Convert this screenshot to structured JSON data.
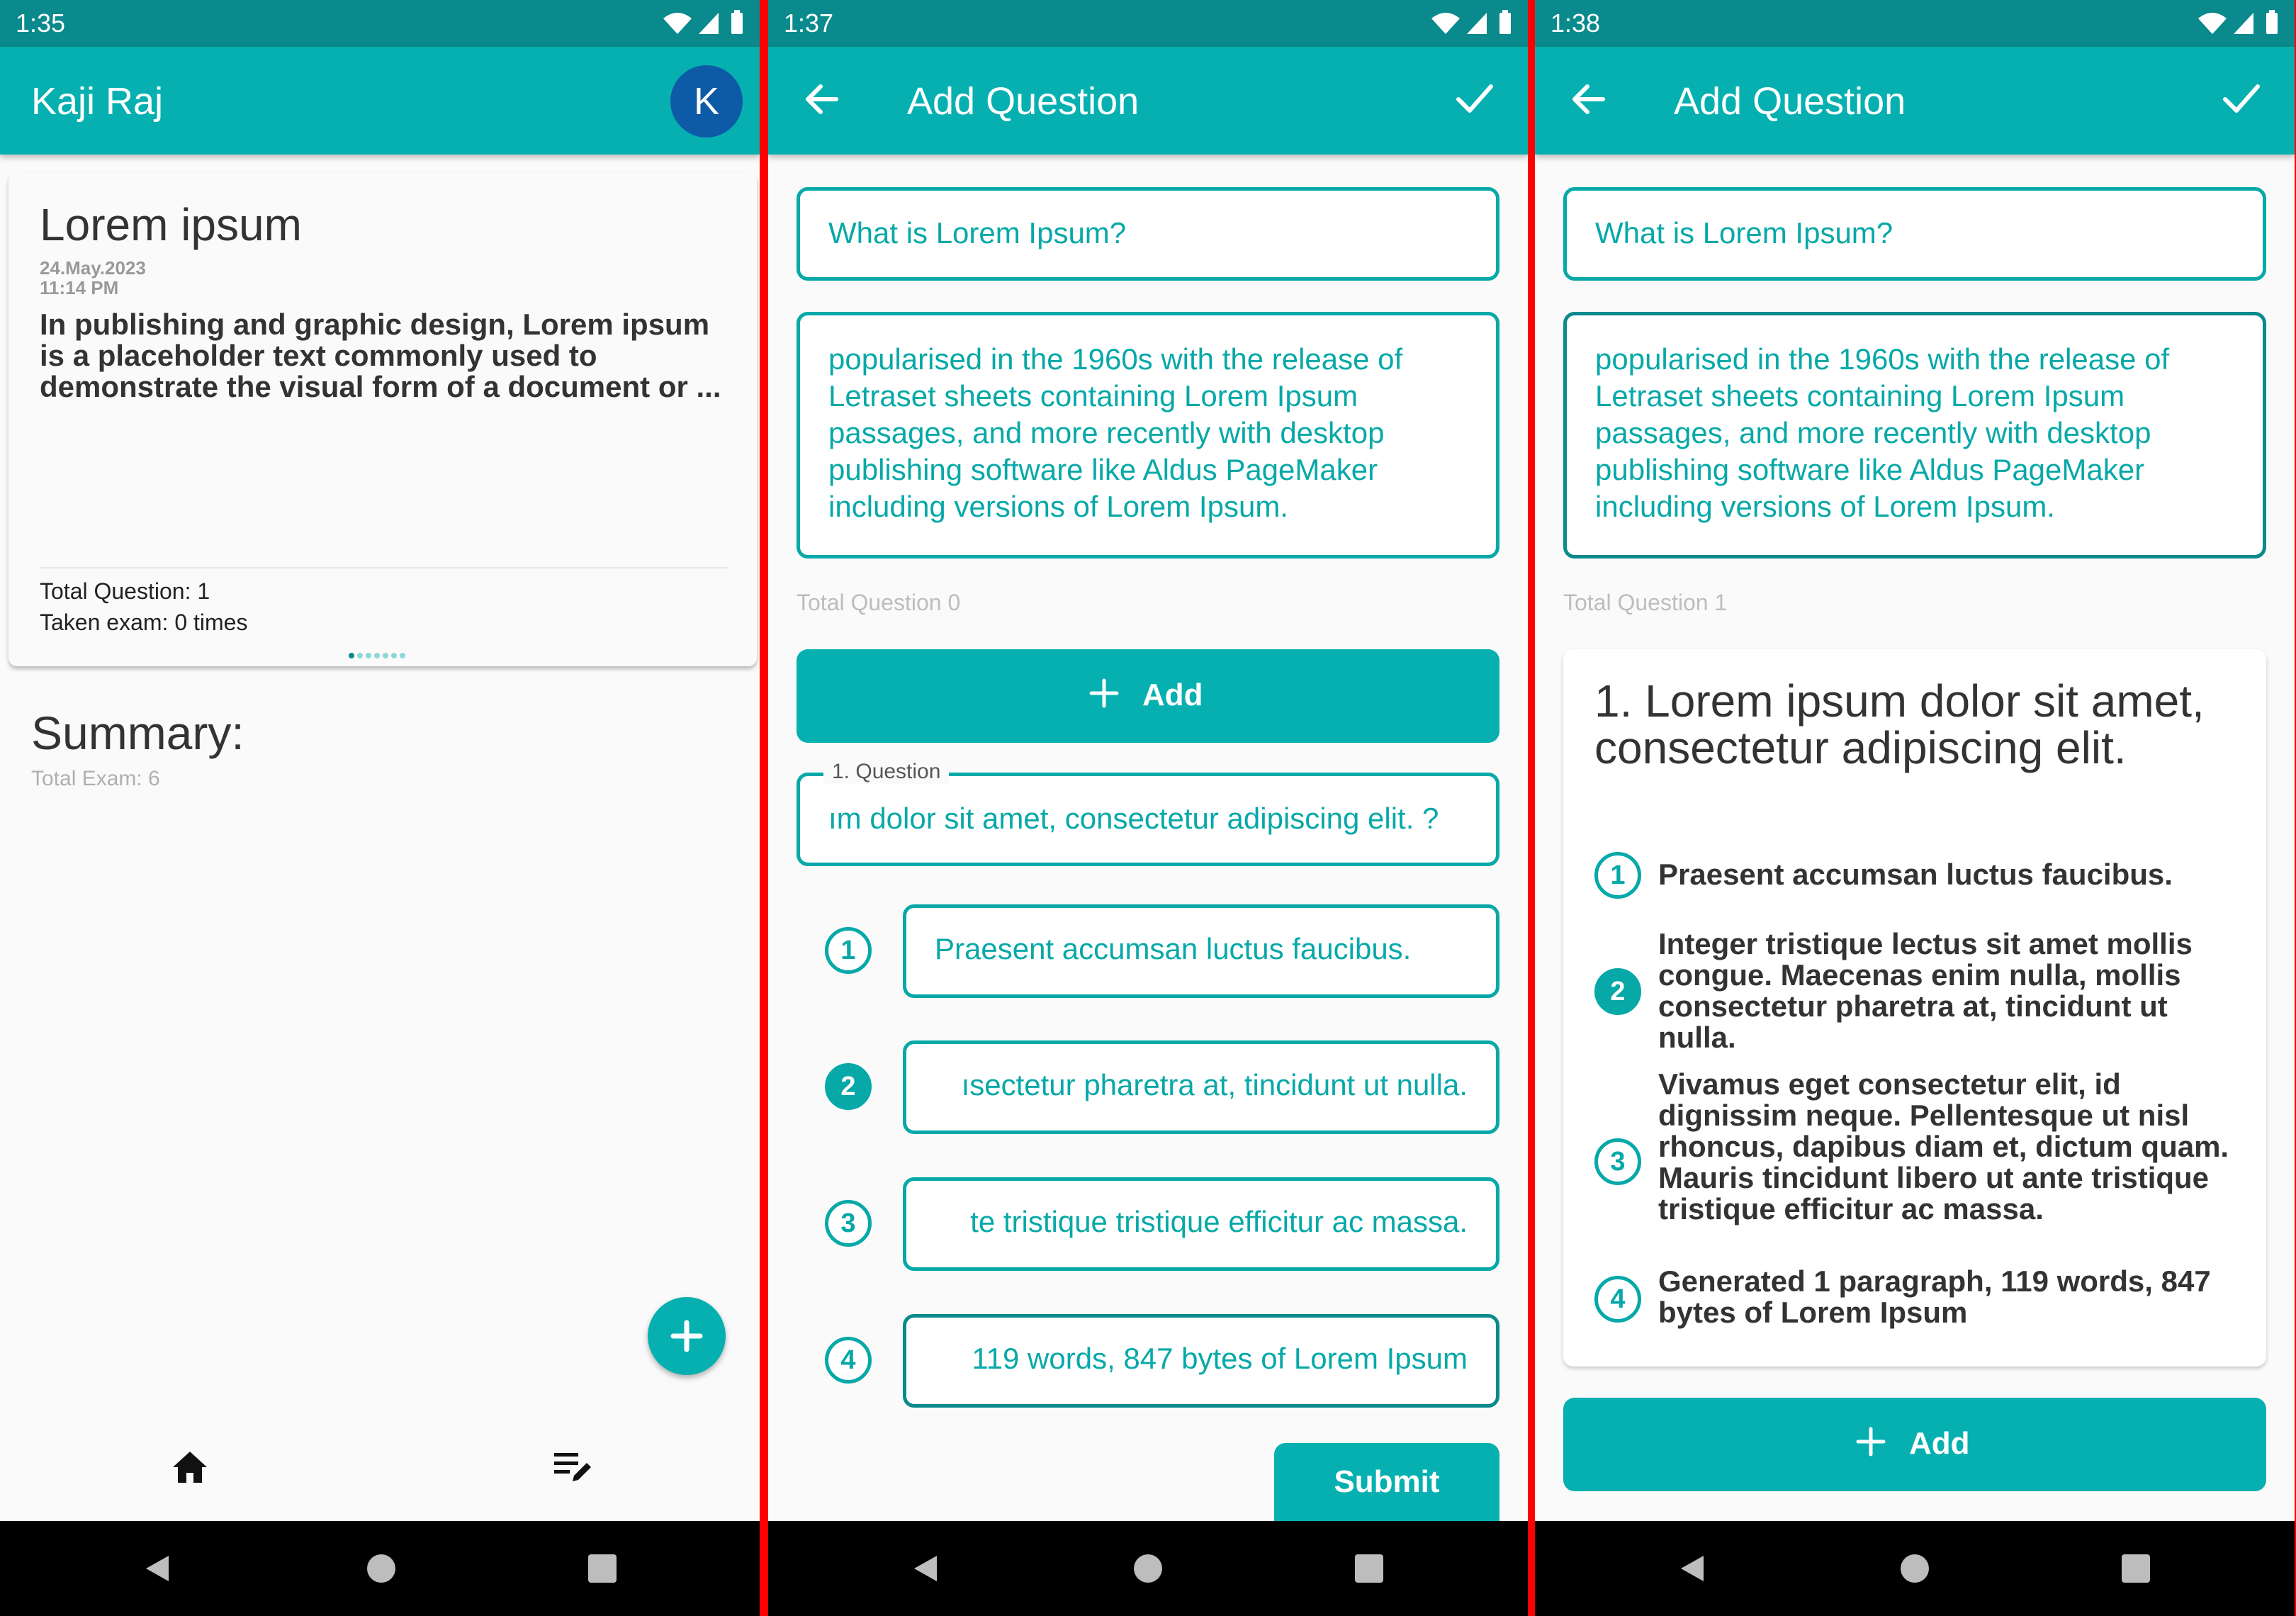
{
  "colors": {
    "teal": "#07b0b0",
    "dark_teal": "#0a8a8c",
    "divider": "#ff0000",
    "avatar": "#0d5aa6"
  },
  "screens": [
    {
      "time": "1:35",
      "app_title": "Kaji Raj",
      "avatar_letter": "K",
      "card": {
        "title": "Lorem ipsum",
        "date": "24.May.2023",
        "time": "11:14 PM",
        "body": "In publishing and graphic design, Lorem ipsum is a placeholder text commonly used to demonstrate the visual form of a document or ...",
        "total_question": "Total Question: 1",
        "taken_exam": "Taken exam: 0 times"
      },
      "summary_title": "Summary:",
      "summary_total": "Total Exam: 6",
      "fab_icon": "plus-icon",
      "nav_items": [
        "home-icon",
        "edit-note-icon"
      ]
    },
    {
      "time": "1:37",
      "app_title": "Add Question",
      "exam_title": "What is Lorem Ipsum?",
      "exam_description": "popularised in the 1960s with the release of Letraset sheets containing Lorem Ipsum passages, and more recently with desktop publishing software like Aldus PageMaker including versions of Lorem Ipsum.",
      "total_question": "Total Question 0",
      "add_label": "Add",
      "question_legend": "1. Question",
      "question_value": "ım dolor sit amet, consectetur adipiscing elit. ?",
      "options": [
        "1",
        "2",
        "3",
        "4"
      ],
      "option_values": [
        "Praesent accumsan luctus faucibus.",
        "ısectetur pharetra at, tincidunt ut nulla.",
        "te tristique tristique efficitur ac massa.",
        "119 words, 847 bytes of Lorem Ipsum"
      ],
      "submit_label": "Submit"
    },
    {
      "time": "1:38",
      "app_title": "Add Question",
      "exam_title": "What is Lorem Ipsum?",
      "exam_description": "popularised in the 1960s with the release of Letraset sheets containing Lorem Ipsum passages, and more recently with desktop publishing software like Aldus PageMaker including versions of Lorem Ipsum.",
      "total_question": "Total Question 1",
      "question_title": "1.  Lorem ipsum dolor sit amet, consectetur adipiscing elit.",
      "options": [
        "1",
        "2",
        "3",
        "4"
      ],
      "option_texts": [
        "Praesent accumsan luctus faucibus.",
        "Integer tristique lectus sit amet mollis congue. Maecenas enim nulla, mollis consectetur pharetra at, tincidunt ut nulla.",
        "Vivamus eget consectetur elit, id dignissim neque. Pellentesque ut nisl rhoncus, dapibus diam et, dictum quam. Mauris tincidunt libero ut ante tristique tristique efficitur ac massa.",
        "Generated 1 paragraph, 119 words, 847 bytes of Lorem Ipsum"
      ],
      "add_label": "Add"
    }
  ]
}
